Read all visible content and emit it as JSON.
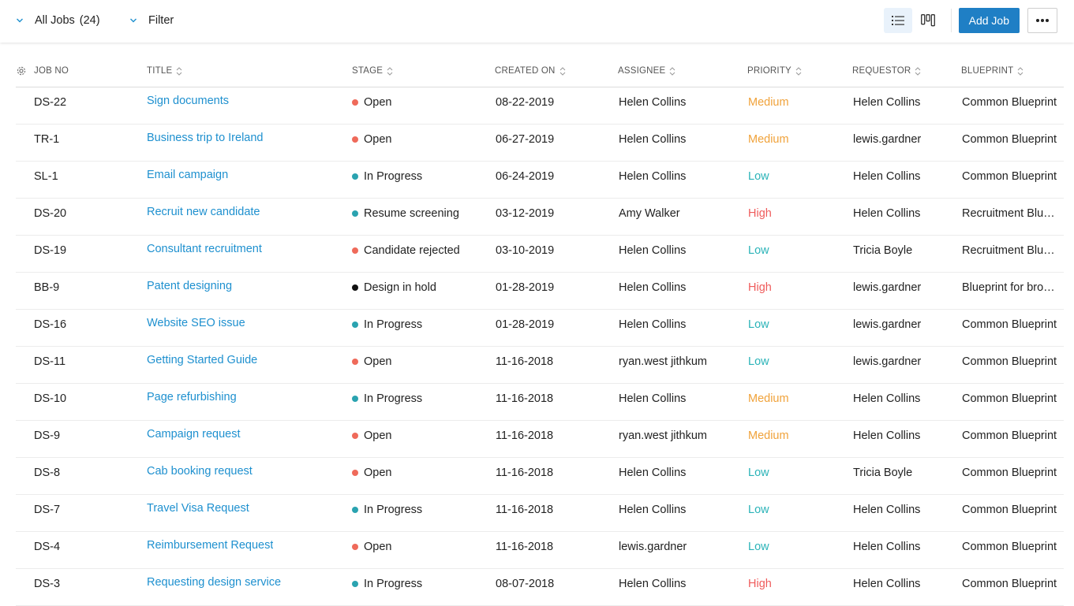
{
  "toolbar": {
    "view_label": "All Jobs",
    "view_count": "(24)",
    "filter_label": "Filter",
    "add_label": "Add Job"
  },
  "colors": {
    "accent": "#1f7fc5",
    "link": "#1e90cf",
    "stage_open": "#ef6a5a",
    "stage_progress": "#2aa3b0",
    "stage_hold": "#111111",
    "priority_medium": "#f0a23a",
    "priority_low": "#2ab3b8",
    "priority_high": "#ef5b5b"
  },
  "columns": {
    "job_no": "JOB NO",
    "title": "TITLE",
    "stage": "STAGE",
    "created": "CREATED ON",
    "assignee": "ASSIGNEE",
    "priority": "PRIORITY",
    "requestor": "REQUESTOR",
    "blueprint": "BLUEPRINT"
  },
  "rows": [
    {
      "no": "DS-22",
      "title": "Sign documents",
      "stage": "Open",
      "stage_type": "open",
      "created": "08-22-2019",
      "assignee": "Helen Collins",
      "priority": "Medium",
      "requestor": "Helen Collins",
      "blueprint": "Common Blueprint"
    },
    {
      "no": "TR-1",
      "title": "Business trip to Ireland",
      "stage": "Open",
      "stage_type": "open",
      "created": "06-27-2019",
      "assignee": "Helen Collins",
      "priority": "Medium",
      "requestor": "lewis.gardner",
      "blueprint": "Common Blueprint"
    },
    {
      "no": "SL-1",
      "title": "Email campaign",
      "stage": "In Progress",
      "stage_type": "progress",
      "created": "06-24-2019",
      "assignee": "Helen Collins",
      "priority": "Low",
      "requestor": "Helen Collins",
      "blueprint": "Common Blueprint"
    },
    {
      "no": "DS-20",
      "title": "Recruit new candidate",
      "stage": "Resume screening",
      "stage_type": "progress",
      "created": "03-12-2019",
      "assignee": "Amy Walker",
      "priority": "High",
      "requestor": "Helen Collins",
      "blueprint": "Recruitment Blueprint"
    },
    {
      "no": "DS-19",
      "title": "Consultant recruitment",
      "stage": "Candidate rejected",
      "stage_type": "open",
      "created": "03-10-2019",
      "assignee": "Helen Collins",
      "priority": "Low",
      "requestor": "Tricia Boyle",
      "blueprint": "Recruitment Blueprint"
    },
    {
      "no": "BB-9",
      "title": "Patent designing",
      "stage": "Design in hold",
      "stage_type": "hold",
      "created": "01-28-2019",
      "assignee": "Helen Collins",
      "priority": "High",
      "requestor": "lewis.gardner",
      "blueprint": "Blueprint for brochure"
    },
    {
      "no": "DS-16",
      "title": "Website SEO issue",
      "stage": "In Progress",
      "stage_type": "progress",
      "created": "01-28-2019",
      "assignee": "Helen Collins",
      "priority": "Low",
      "requestor": "lewis.gardner",
      "blueprint": "Common Blueprint"
    },
    {
      "no": "DS-11",
      "title": "Getting Started Guide",
      "stage": "Open",
      "stage_type": "open",
      "created": "11-16-2018",
      "assignee": "ryan.west jithkum",
      "priority": "Low",
      "requestor": "lewis.gardner",
      "blueprint": "Common Blueprint"
    },
    {
      "no": "DS-10",
      "title": "Page refurbishing",
      "stage": "In Progress",
      "stage_type": "progress",
      "created": "11-16-2018",
      "assignee": "Helen Collins",
      "priority": "Medium",
      "requestor": "Helen Collins",
      "blueprint": "Common Blueprint"
    },
    {
      "no": "DS-9",
      "title": "Campaign request",
      "stage": "Open",
      "stage_type": "open",
      "created": "11-16-2018",
      "assignee": "ryan.west jithkum",
      "priority": "Medium",
      "requestor": "Helen Collins",
      "blueprint": "Common Blueprint"
    },
    {
      "no": "DS-8",
      "title": "Cab booking request",
      "stage": "Open",
      "stage_type": "open",
      "created": "11-16-2018",
      "assignee": "Helen Collins",
      "priority": "Low",
      "requestor": "Tricia Boyle",
      "blueprint": "Common Blueprint"
    },
    {
      "no": "DS-7",
      "title": "Travel Visa Request",
      "stage": "In Progress",
      "stage_type": "progress",
      "created": "11-16-2018",
      "assignee": "Helen Collins",
      "priority": "Low",
      "requestor": "Helen Collins",
      "blueprint": "Common Blueprint"
    },
    {
      "no": "DS-4",
      "title": "Reimbursement Request",
      "stage": "Open",
      "stage_type": "open",
      "created": "11-16-2018",
      "assignee": "lewis.gardner",
      "priority": "Low",
      "requestor": "Helen Collins",
      "blueprint": "Common Blueprint"
    },
    {
      "no": "DS-3",
      "title": "Requesting design service",
      "stage": "In Progress",
      "stage_type": "progress",
      "created": "08-07-2018",
      "assignee": "Helen Collins",
      "priority": "High",
      "requestor": "Helen Collins",
      "blueprint": "Common Blueprint"
    }
  ]
}
